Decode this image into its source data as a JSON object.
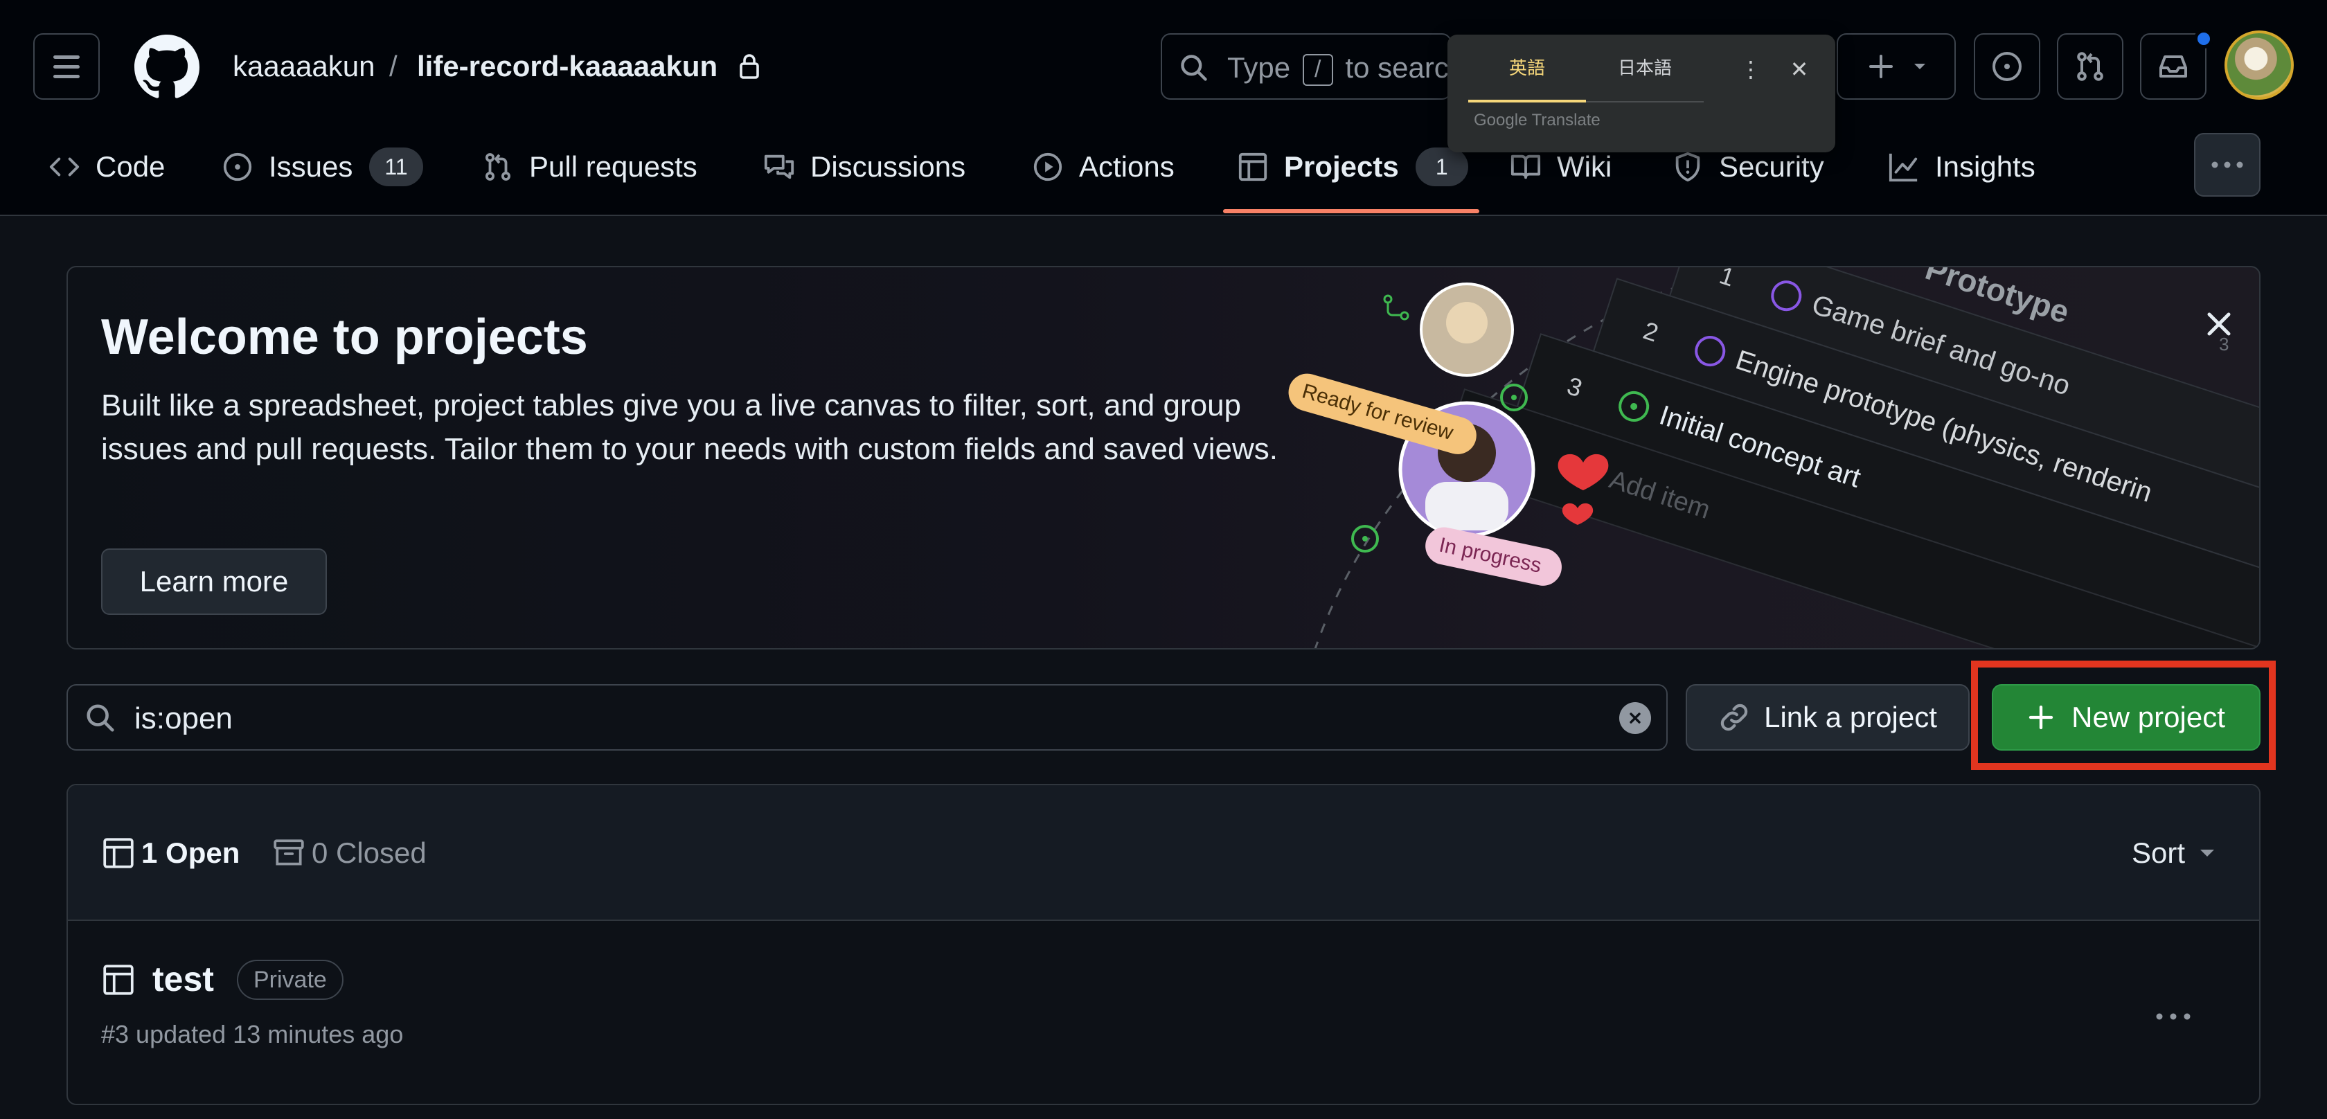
{
  "header": {
    "owner": "kaaaaakun",
    "separator": "/",
    "repo": "life-record-kaaaaakun",
    "search_prefix": "Type",
    "search_key": "/",
    "search_suffix": "to searc"
  },
  "translate_popup": {
    "tab_source": "英語",
    "tab_target": "日本語",
    "brand": "Google Translate"
  },
  "nav": {
    "code": "Code",
    "issues": "Issues",
    "issues_count": "11",
    "pull_requests": "Pull requests",
    "discussions": "Discussions",
    "actions": "Actions",
    "projects": "Projects",
    "projects_count": "1",
    "wiki": "Wiki",
    "security": "Security",
    "insights": "Insights"
  },
  "banner": {
    "title": "Welcome to projects",
    "description": "Built like a spreadsheet, project tables give you a live canvas to filter, sort, and group issues and pull requests. Tailor them to your needs with custom fields and saved views.",
    "learn_more": "Learn more",
    "art": {
      "prototype": "Prototype",
      "row1_num": "1",
      "row1_text": "Game brief and go-no",
      "row2_num": "2",
      "row2_text": "Engine prototype (physics, renderin",
      "row3_num": "3",
      "row3_text": "Initial concept art",
      "add_item": "Add item",
      "ready": "Ready for review",
      "in_progress": "In progress",
      "corner_num": "3"
    }
  },
  "filter": {
    "query": "is:open",
    "link_project": "Link a project",
    "new_project": "New project"
  },
  "list": {
    "open_label": "1 Open",
    "closed_label": "0 Closed",
    "sort_label": "Sort",
    "items": [
      {
        "title": "test",
        "badge": "Private",
        "meta": "#3 updated 13 minutes ago"
      }
    ]
  },
  "colors": {
    "background": "#0d1117",
    "header_bg": "#010409",
    "accent_tab": "#f78166",
    "primary_button": "#238636",
    "highlight_box": "#e2351f"
  }
}
